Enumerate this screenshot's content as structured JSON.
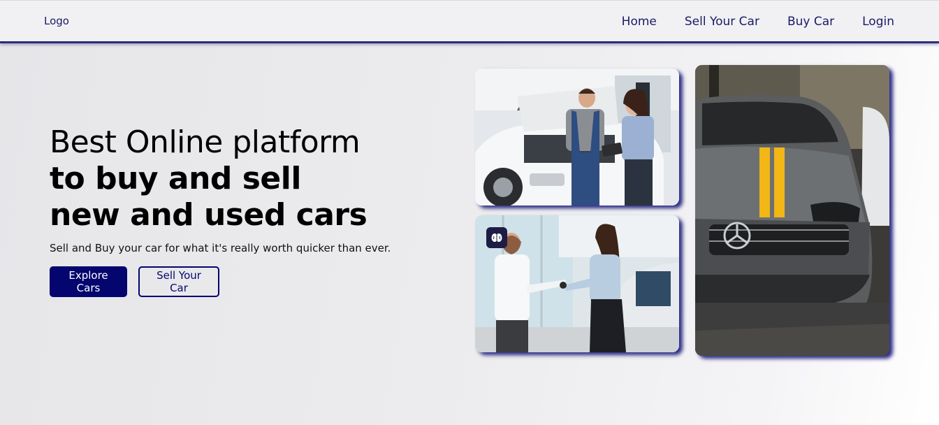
{
  "navbar": {
    "logo": "Logo",
    "links": [
      "Home",
      "Sell Your Car",
      "Buy Car",
      "Login"
    ]
  },
  "hero": {
    "line1": "Best Online platform",
    "line2": "to buy and sell",
    "line3": "new and used cars",
    "subtitle": "Sell and Buy your car for what it's really worth quicker than ever.",
    "primary_button": "Explore Cars",
    "secondary_button": "Sell Your Car"
  },
  "gallery": {
    "images": [
      "mechanic-and-customer-photo",
      "car-key-handover-photo",
      "grey-sports-car-photo"
    ],
    "badge_icon": "brain-icon"
  },
  "colors": {
    "brand": "#04056e",
    "nav_text": "#1a1a66",
    "shadow": "#2d2c7a"
  }
}
